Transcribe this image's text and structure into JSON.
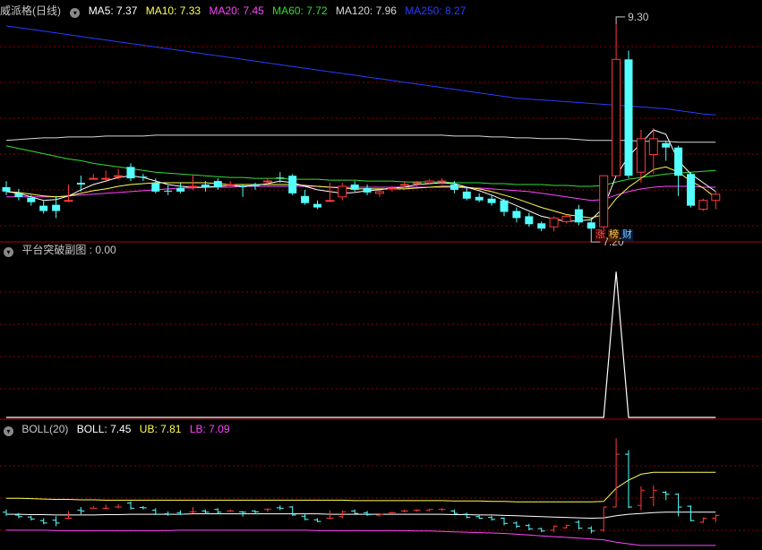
{
  "main_panel": {
    "title": "威派格(日线)",
    "indicators": [
      {
        "label": "MA5: 7.37",
        "color": "#ffffff"
      },
      {
        "label": "MA10: 7.33",
        "color": "#ffff55"
      },
      {
        "label": "MA20: 7.45",
        "color": "#ff44ff"
      },
      {
        "label": "MA60: 7.72",
        "color": "#33dd33"
      },
      {
        "label": "MA120: 7.96",
        "color": "#d8d8d8"
      },
      {
        "label": "MA250: 8.27",
        "color": "#2a3cff"
      }
    ],
    "max_label": "9.30",
    "min_label": "7.20",
    "tags": [
      {
        "text": "涨",
        "color": "#ff5555",
        "bg": "#3a0000"
      },
      {
        "text": "榜",
        "color": "#ffcc55",
        "bg": "#3a1a00"
      },
      {
        "text": "财",
        "color": "#88ccff",
        "bg": "#001a3a"
      }
    ]
  },
  "sub_panel1": {
    "title": "平台突破副图 : 0.00",
    "dropdown_icon": "chevron-down-icon"
  },
  "sub_panel2": {
    "indicators": [
      {
        "label": "BOLL(20)",
        "color": "#c8c8c8"
      },
      {
        "label": "BOLL: 7.45",
        "color": "#ffffff"
      },
      {
        "label": "UB: 7.81",
        "color": "#ffff55"
      },
      {
        "label": "LB: 7.09",
        "color": "#ff44ff"
      }
    ]
  },
  "colors": {
    "up": "#ff3a3a",
    "down": "#54ffff",
    "grid": "#8b0000",
    "panel_border": "#b00000"
  },
  "chart_data": {
    "type": "candlestick",
    "series_name": "威派格(日线)",
    "ohlc": [
      [
        7.45,
        7.52,
        7.4,
        7.36
      ],
      [
        7.38,
        7.43,
        7.34,
        7.3
      ],
      [
        7.33,
        7.36,
        7.28,
        7.24
      ],
      [
        7.24,
        7.3,
        7.18,
        7.15
      ],
      [
        7.25,
        7.35,
        7.18,
        7.1
      ],
      [
        7.3,
        7.48,
        7.3,
        7.28
      ],
      [
        7.5,
        7.58,
        7.48,
        7.4
      ],
      [
        7.55,
        7.6,
        7.55,
        7.55
      ],
      [
        7.55,
        7.64,
        7.55,
        7.52
      ],
      [
        7.58,
        7.66,
        7.58,
        7.54
      ],
      [
        7.68,
        7.72,
        7.55,
        7.52
      ],
      [
        7.57,
        7.6,
        7.56,
        7.52
      ],
      [
        7.5,
        7.55,
        7.4,
        7.38
      ],
      [
        7.41,
        7.47,
        7.4,
        7.36
      ],
      [
        7.44,
        7.5,
        7.4,
        7.38
      ],
      [
        7.46,
        7.58,
        7.46,
        7.42
      ],
      [
        7.48,
        7.52,
        7.45,
        7.4
      ],
      [
        7.52,
        7.55,
        7.45,
        7.42
      ],
      [
        7.48,
        7.52,
        7.48,
        7.46
      ],
      [
        7.46,
        7.48,
        7.45,
        7.34
      ],
      [
        7.48,
        7.5,
        7.46,
        7.42
      ],
      [
        7.52,
        7.55,
        7.52,
        7.46
      ],
      [
        7.56,
        7.62,
        7.55,
        7.5
      ],
      [
        7.58,
        7.6,
        7.38,
        7.36
      ],
      [
        7.35,
        7.42,
        7.27,
        7.25
      ],
      [
        7.26,
        7.3,
        7.22,
        7.2
      ],
      [
        7.3,
        7.5,
        7.3,
        7.28
      ],
      [
        7.34,
        7.5,
        7.46,
        7.3
      ],
      [
        7.48,
        7.52,
        7.42,
        7.4
      ],
      [
        7.44,
        7.48,
        7.39,
        7.36
      ],
      [
        7.38,
        7.42,
        7.4,
        7.34
      ],
      [
        7.44,
        7.46,
        7.44,
        7.4
      ],
      [
        7.48,
        7.52,
        7.48,
        7.44
      ],
      [
        7.5,
        7.52,
        7.5,
        7.46
      ],
      [
        7.5,
        7.54,
        7.52,
        7.48
      ],
      [
        7.52,
        7.55,
        7.52,
        7.48
      ],
      [
        7.48,
        7.52,
        7.42,
        7.38
      ],
      [
        7.4,
        7.44,
        7.32,
        7.3
      ],
      [
        7.34,
        7.38,
        7.3,
        7.28
      ],
      [
        7.32,
        7.36,
        7.27,
        7.24
      ],
      [
        7.3,
        7.32,
        7.17,
        7.12
      ],
      [
        7.18,
        7.22,
        7.1,
        7.05
      ],
      [
        7.12,
        7.16,
        7.03,
        7.0
      ],
      [
        7.04,
        7.06,
        6.98,
        6.95
      ],
      [
        7.0,
        7.12,
        7.1,
        6.95
      ],
      [
        7.06,
        7.14,
        7.12,
        7.04
      ],
      [
        7.2,
        7.25,
        7.05,
        7.02
      ],
      [
        7.05,
        7.1,
        6.98,
        6.92
      ],
      [
        7.0,
        7.58,
        7.58,
        6.96
      ],
      [
        7.58,
        9.3,
        8.9,
        7.58
      ],
      [
        8.9,
        9.0,
        7.58,
        7.55
      ],
      [
        7.62,
        8.1,
        8.0,
        7.5
      ],
      [
        7.82,
        8.12,
        8.0,
        7.6
      ],
      [
        7.95,
        7.98,
        7.9,
        7.75
      ],
      [
        7.9,
        7.92,
        7.58,
        7.35
      ],
      [
        7.6,
        7.62,
        7.24,
        7.22
      ],
      [
        7.2,
        7.32,
        7.3,
        7.18
      ],
      [
        7.3,
        7.4,
        7.37,
        7.2
      ]
    ],
    "moving_averages": {
      "MA5": [
        7.4,
        7.38,
        7.34,
        7.3,
        7.31,
        7.35,
        7.42,
        7.48,
        7.52,
        7.56,
        7.58,
        7.56,
        7.52,
        7.48,
        7.46,
        7.45,
        7.45,
        7.46,
        7.47,
        7.46,
        7.47,
        7.49,
        7.52,
        7.5,
        7.46,
        7.42,
        7.4,
        7.38,
        7.39,
        7.41,
        7.42,
        7.44,
        7.45,
        7.48,
        7.49,
        7.5,
        7.49,
        7.45,
        7.41,
        7.36,
        7.3,
        7.24,
        7.18,
        7.12,
        7.09,
        7.06,
        7.07,
        7.08,
        7.22,
        7.58,
        7.8,
        7.95,
        8.1,
        8.05,
        7.75,
        7.6,
        7.5,
        7.4
      ],
      "MA10": [
        7.4,
        7.39,
        7.37,
        7.35,
        7.34,
        7.35,
        7.38,
        7.41,
        7.43,
        7.46,
        7.48,
        7.49,
        7.5,
        7.5,
        7.5,
        7.5,
        7.5,
        7.49,
        7.48,
        7.48,
        7.48,
        7.48,
        7.48,
        7.48,
        7.47,
        7.46,
        7.45,
        7.44,
        7.43,
        7.43,
        7.43,
        7.43,
        7.43,
        7.44,
        7.45,
        7.46,
        7.46,
        7.45,
        7.43,
        7.4,
        7.36,
        7.32,
        7.27,
        7.22,
        7.18,
        7.14,
        7.12,
        7.1,
        7.14,
        7.32,
        7.45,
        7.55,
        7.65,
        7.68,
        7.62,
        7.52,
        7.44,
        7.33
      ],
      "MA20": [
        7.34,
        7.34,
        7.34,
        7.34,
        7.34,
        7.35,
        7.36,
        7.37,
        7.38,
        7.39,
        7.4,
        7.41,
        7.42,
        7.43,
        7.44,
        7.44,
        7.45,
        7.45,
        7.45,
        7.46,
        7.46,
        7.46,
        7.46,
        7.46,
        7.46,
        7.46,
        7.45,
        7.45,
        7.45,
        7.45,
        7.45,
        7.45,
        7.45,
        7.45,
        7.45,
        7.45,
        7.45,
        7.44,
        7.44,
        7.43,
        7.42,
        7.41,
        7.4,
        7.38,
        7.36,
        7.34,
        7.32,
        7.3,
        7.31,
        7.36,
        7.4,
        7.43,
        7.45,
        7.46,
        7.46,
        7.46,
        7.45,
        7.45
      ],
      "MA60": [
        7.92,
        7.89,
        7.86,
        7.83,
        7.8,
        7.77,
        7.75,
        7.72,
        7.7,
        7.68,
        7.66,
        7.64,
        7.62,
        7.61,
        7.6,
        7.59,
        7.58,
        7.57,
        7.56,
        7.56,
        7.55,
        7.55,
        7.55,
        7.54,
        7.54,
        7.54,
        7.53,
        7.53,
        7.53,
        7.52,
        7.52,
        7.52,
        7.51,
        7.51,
        7.51,
        7.51,
        7.5,
        7.5,
        7.5,
        7.49,
        7.49,
        7.48,
        7.48,
        7.48,
        7.47,
        7.47,
        7.46,
        7.46,
        7.47,
        7.51,
        7.54,
        7.56,
        7.58,
        7.6,
        7.61,
        7.62,
        7.63,
        7.64
      ],
      "MA120": [
        7.98,
        7.99,
        8.0,
        8.01,
        8.01,
        8.02,
        8.02,
        8.02,
        8.03,
        8.03,
        8.03,
        8.03,
        8.04,
        8.04,
        8.04,
        8.04,
        8.04,
        8.04,
        8.04,
        8.04,
        8.04,
        8.04,
        8.04,
        8.04,
        8.04,
        8.04,
        8.04,
        8.04,
        8.04,
        8.04,
        8.04,
        8.04,
        8.04,
        8.04,
        8.04,
        8.04,
        8.03,
        8.03,
        8.03,
        8.02,
        8.02,
        8.01,
        8.01,
        8.0,
        8.0,
        8.0,
        7.99,
        7.98,
        7.98,
        7.98,
        7.98,
        7.97,
        7.97,
        7.97,
        7.96,
        7.96,
        7.96,
        7.96
      ],
      "MA250": [
        9.28,
        9.26,
        9.24,
        9.22,
        9.2,
        9.18,
        9.16,
        9.14,
        9.12,
        9.1,
        9.08,
        9.06,
        9.04,
        9.02,
        9.0,
        8.98,
        8.96,
        8.94,
        8.92,
        8.9,
        8.88,
        8.86,
        8.84,
        8.82,
        8.8,
        8.78,
        8.76,
        8.74,
        8.72,
        8.7,
        8.68,
        8.66,
        8.64,
        8.62,
        8.6,
        8.58,
        8.56,
        8.54,
        8.52,
        8.5,
        8.48,
        8.46,
        8.45,
        8.44,
        8.43,
        8.42,
        8.41,
        8.4,
        8.39,
        8.38,
        8.37,
        8.36,
        8.35,
        8.34,
        8.32,
        8.3,
        8.28,
        8.27
      ]
    },
    "ylim": [
      6.85,
      9.35
    ],
    "platform_breakout": {
      "values_index_of_spike": 49,
      "spike_value": 1,
      "ylim": [
        0,
        1.1
      ]
    },
    "boll": {
      "UB": [
        7.8,
        7.8,
        7.79,
        7.78,
        7.77,
        7.77,
        7.76,
        7.76,
        7.75,
        7.75,
        7.75,
        7.75,
        7.75,
        7.75,
        7.75,
        7.75,
        7.75,
        7.75,
        7.75,
        7.75,
        7.75,
        7.75,
        7.75,
        7.75,
        7.75,
        7.75,
        7.75,
        7.75,
        7.74,
        7.74,
        7.74,
        7.74,
        7.74,
        7.74,
        7.74,
        7.74,
        7.73,
        7.73,
        7.73,
        7.72,
        7.72,
        7.71,
        7.71,
        7.71,
        7.71,
        7.71,
        7.71,
        7.71,
        7.72,
        8.05,
        8.25,
        8.4,
        8.45,
        8.45,
        8.45,
        8.45,
        8.45,
        8.45
      ],
      "MID": [
        7.4,
        7.4,
        7.39,
        7.39,
        7.38,
        7.38,
        7.38,
        7.38,
        7.39,
        7.39,
        7.4,
        7.4,
        7.4,
        7.4,
        7.4,
        7.41,
        7.41,
        7.41,
        7.41,
        7.41,
        7.41,
        7.41,
        7.41,
        7.41,
        7.41,
        7.41,
        7.4,
        7.4,
        7.4,
        7.4,
        7.4,
        7.4,
        7.4,
        7.4,
        7.4,
        7.4,
        7.39,
        7.39,
        7.38,
        7.38,
        7.37,
        7.36,
        7.35,
        7.34,
        7.33,
        7.32,
        7.31,
        7.3,
        7.31,
        7.36,
        7.4,
        7.42,
        7.44,
        7.45,
        7.45,
        7.45,
        7.45,
        7.45
      ],
      "LB": [
        7.0,
        7.0,
        7.0,
        7.0,
        6.99,
        6.99,
        6.99,
        6.99,
        6.99,
        6.99,
        6.99,
        6.99,
        6.99,
        6.99,
        7.0,
        7.0,
        7.0,
        7.0,
        7.0,
        7.0,
        7.0,
        7.0,
        7.0,
        7.0,
        7.0,
        6.99,
        6.99,
        6.99,
        6.99,
        6.99,
        6.99,
        6.99,
        6.99,
        6.98,
        6.98,
        6.97,
        6.96,
        6.95,
        6.94,
        6.93,
        6.92,
        6.9,
        6.88,
        6.86,
        6.84,
        6.82,
        6.8,
        6.78,
        6.76,
        6.7,
        6.66,
        6.62,
        6.62,
        6.62,
        6.62,
        6.62,
        6.62,
        6.62
      ],
      "ylim": [
        6.55,
        9.35
      ]
    }
  }
}
